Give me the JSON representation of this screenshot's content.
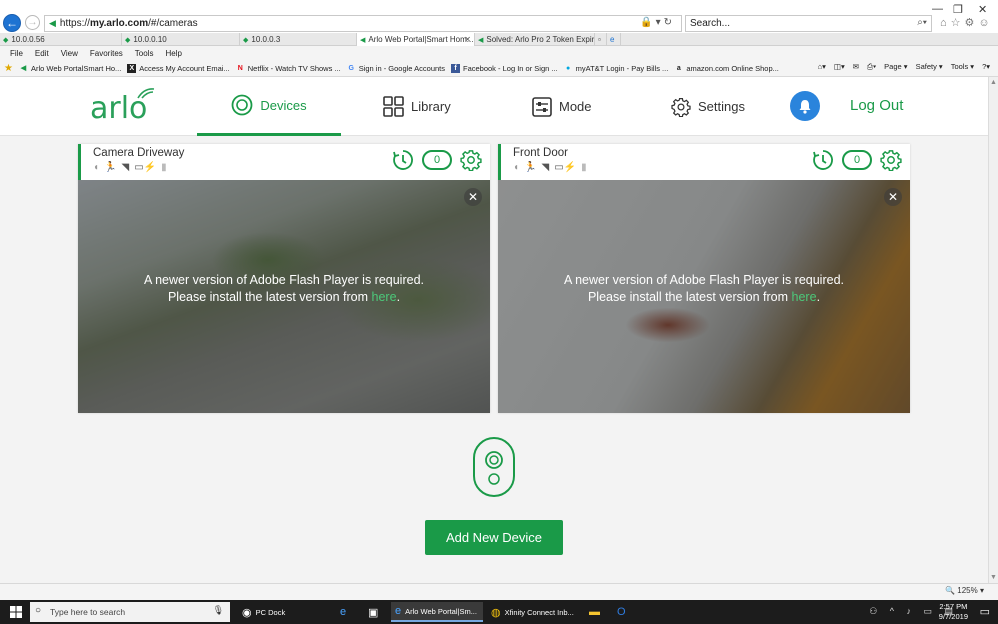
{
  "browser": {
    "url_prefix": "https://",
    "url_host": "my.arlo.com",
    "url_path": "/#/cameras",
    "search_placeholder": "Search...",
    "tabs": [
      {
        "label": "10.0.0.56"
      },
      {
        "label": "10.0.0.10"
      },
      {
        "label": "10.0.0.3"
      },
      {
        "label": "Arlo Web Portal|Smart Hom..."
      },
      {
        "label": "Solved: Arlo Pro 2 Token Expire..."
      }
    ],
    "menu": [
      "File",
      "Edit",
      "View",
      "Favorites",
      "Tools",
      "Help"
    ],
    "favorites": [
      {
        "label": "Arlo Web PortalSmart Ho...",
        "icon": "arlo-fav-icon"
      },
      {
        "label": "Access My Account  Emai...",
        "icon": "x-fav-icon"
      },
      {
        "label": "Netflix - Watch TV Shows ...",
        "icon": "netflix-fav-icon"
      },
      {
        "label": "Sign in - Google Accounts",
        "icon": "google-fav-icon"
      },
      {
        "label": "Facebook - Log In or Sign ...",
        "icon": "facebook-fav-icon"
      },
      {
        "label": "myAT&T Login - Pay Bills ...",
        "icon": "att-fav-icon"
      },
      {
        "label": "amazon.com Online Shop...",
        "icon": "amazon-fav-icon"
      }
    ],
    "command_bar": [
      "Page",
      "Safety",
      "Tools"
    ],
    "zoom": "125%"
  },
  "arlo": {
    "logo": "arlo",
    "nav": {
      "devices": "Devices",
      "library": "Library",
      "mode": "Mode",
      "settings": "Settings",
      "logout": "Log Out"
    },
    "cameras": [
      {
        "name": "Camera Driveway",
        "count": "0",
        "flash_line1": "A newer version of Adobe Flash Player is required.",
        "flash_line2": "Please install the latest version from",
        "flash_link": "here",
        "flash_end": "."
      },
      {
        "name": "Front Door",
        "count": "0",
        "flash_line1": "A newer version of Adobe Flash Player is required.",
        "flash_line2": "Please install the latest version from",
        "flash_link": "here",
        "flash_end": "."
      }
    ],
    "add_device": "Add New Device"
  },
  "taskbar": {
    "search_placeholder": "Type here to search",
    "apps": [
      {
        "label": "PC Dock"
      },
      {
        "label": "Arlo Web Portal|Sm..."
      },
      {
        "label": "Xfinity Connect Inb..."
      }
    ],
    "time": "2:57 PM",
    "date": "9/7/2019"
  },
  "colors": {
    "arlo_green": "#1a9a48",
    "bell_blue": "#2a84dc",
    "motion_orange": "#e8a020"
  }
}
